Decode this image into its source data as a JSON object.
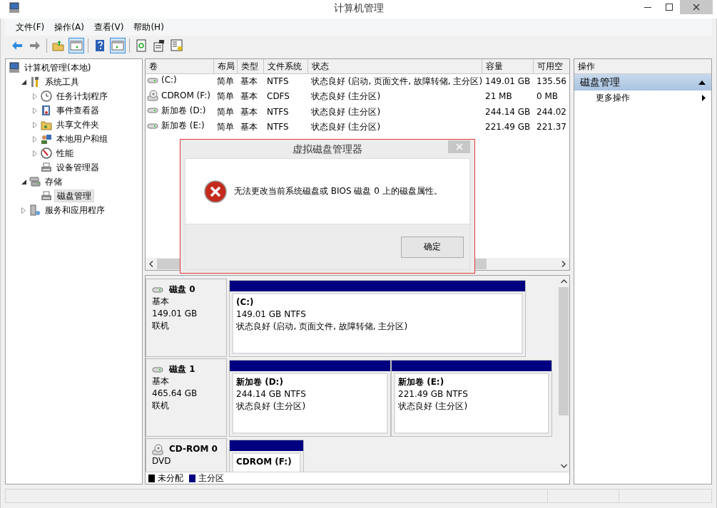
{
  "window": {
    "title": "计算机管理"
  },
  "menu": [
    "文件(F)",
    "操作(A)",
    "查看(V)",
    "帮助(H)"
  ],
  "toolbar": [
    [
      {
        "kind": "back",
        "pressed": false
      },
      {
        "kind": "forward",
        "pressed": false
      }
    ],
    [
      {
        "kind": "up",
        "pressed": false
      },
      {
        "kind": "pane",
        "pressed": true
      }
    ],
    [
      {
        "kind": "help",
        "pressed": false
      },
      {
        "kind": "pane2",
        "pressed": true
      }
    ],
    [
      {
        "kind": "refresh",
        "pressed": false
      },
      {
        "kind": "props",
        "pressed": false
      },
      {
        "kind": "settings",
        "pressed": false
      }
    ]
  ],
  "tree": [
    {
      "label": "计算机管理(本地)",
      "kind": "computer",
      "selected": false,
      "children": [
        {
          "label": "系统工具",
          "kind": "tools",
          "expanded": true,
          "selected": false,
          "children": [
            {
              "label": "任务计划程序",
              "kind": "clock",
              "expanded": false,
              "selected": false
            },
            {
              "label": "事件查看器",
              "kind": "log",
              "expanded": false,
              "selected": false
            },
            {
              "label": "共享文件夹",
              "kind": "folder",
              "expanded": false,
              "selected": false
            },
            {
              "label": "本地用户和组",
              "kind": "users",
              "expanded": false,
              "selected": false
            },
            {
              "label": "性能",
              "kind": "gauge",
              "expanded": false,
              "selected": false
            },
            {
              "label": "设备管理器",
              "kind": "device",
              "selected": false
            }
          ]
        },
        {
          "label": "存储",
          "kind": "storage",
          "expanded": true,
          "selected": false,
          "children": [
            {
              "label": "磁盘管理",
              "kind": "device",
              "selected": true
            }
          ]
        },
        {
          "label": "服务和应用程序",
          "kind": "server",
          "expanded": false,
          "selected": false
        }
      ]
    }
  ],
  "volumes": {
    "columns": [
      "卷",
      "布局",
      "类型",
      "文件系统",
      "状态",
      "容量",
      "可用空"
    ],
    "rows": [
      {
        "kind": "disk",
        "cells": [
          "(C:)",
          "简单",
          "基本",
          "NTFS",
          "状态良好 (启动, 页面文件, 故障转储, 主分区)",
          "149.01 GB",
          "135.56"
        ]
      },
      {
        "kind": "cdrom",
        "cells": [
          "CDROM (F:)",
          "简单",
          "基本",
          "CDFS",
          "状态良好 (主分区)",
          "21 MB",
          "0 MB"
        ]
      },
      {
        "kind": "disk",
        "cells": [
          "新加卷 (D:)",
          "简单",
          "基本",
          "NTFS",
          "状态良好 (主分区)",
          "244.14 GB",
          "244.02"
        ]
      },
      {
        "kind": "disk",
        "cells": [
          "新加卷 (E:)",
          "简单",
          "基本",
          "NTFS",
          "状态良好 (主分区)",
          "221.49 GB",
          "221.37"
        ]
      }
    ]
  },
  "disks": [
    {
      "kind": "disk",
      "name": "磁盘 0",
      "type": "基本",
      "size": "149.01 GB",
      "status": "联机",
      "partitions": [
        {
          "label": "(C:)",
          "info": "149.01 GB NTFS",
          "status": "状态良好 (启动, 页面文件, 故障转储, 主分区)",
          "color": "#000080"
        }
      ]
    },
    {
      "kind": "disk",
      "name": "磁盘 1",
      "type": "基本",
      "size": "465.64 GB",
      "status": "联机",
      "partitions": [
        {
          "label": "新加卷  (D:)",
          "info": "244.14 GB NTFS",
          "status": "状态良好 (主分区)",
          "color": "#000080"
        },
        {
          "label": "新加卷  (E:)",
          "info": "221.49 GB NTFS",
          "status": "状态良好 (主分区)",
          "color": "#000080"
        }
      ]
    },
    {
      "kind": "cdrom",
      "name": "CD-ROM 0",
      "type": "DVD",
      "partitions": [
        {
          "label": "CDROM  (F:)",
          "color": "#000080"
        }
      ]
    }
  ],
  "legend": [
    {
      "label": "未分配",
      "color": "#000000"
    },
    {
      "label": "主分区",
      "color": "#000080"
    }
  ],
  "actions": {
    "header": "操作",
    "section": {
      "title": "磁盘管理",
      "expanded": true,
      "items": [
        "更多操作"
      ]
    }
  },
  "dialog": {
    "title": "虚拟磁盘管理器",
    "message": "无法更改当前系统磁盘或 BIOS 磁盘 0 上的磁盘属性。",
    "button": "确定"
  }
}
